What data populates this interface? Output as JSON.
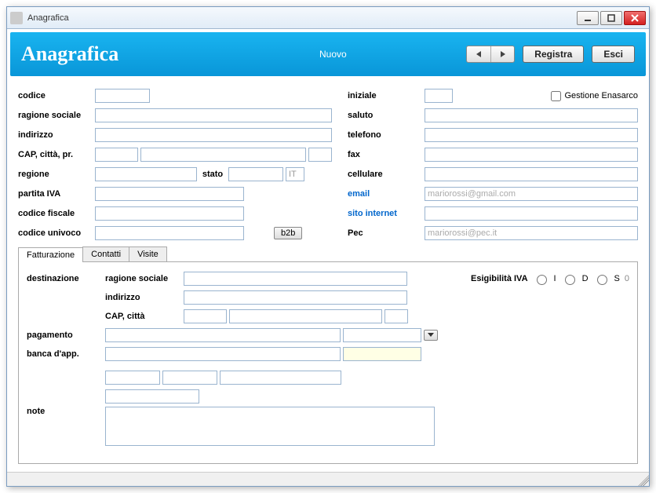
{
  "window": {
    "title": "Anagrafica"
  },
  "header": {
    "title": "Anagrafica",
    "status": "Nuovo",
    "registra": "Registra",
    "esci": "Esci"
  },
  "left": {
    "codice": "codice",
    "ragione_sociale": "ragione sociale",
    "indirizzo": "indirizzo",
    "cap_citta_pr": "CAP, città, pr.",
    "regione": "regione",
    "stato": "stato",
    "stato_val": "IT",
    "partita_iva": "partita IVA",
    "codice_fiscale": "codice fiscale",
    "codice_univoco": "codice univoco",
    "b2b": "b2b"
  },
  "right": {
    "iniziale": "iniziale",
    "gestione_enasarco": "Gestione Enasarco",
    "saluto": "saluto",
    "telefono": "telefono",
    "fax": "fax",
    "cellulare": "cellulare",
    "email": "email",
    "email_ph": "mariorossi@gmail.com",
    "sito": "sito internet",
    "pec": "Pec",
    "pec_ph": "mariorossi@pec.it"
  },
  "tabs": {
    "fatturazione": "Fatturazione",
    "contatti": "Contatti",
    "visite": "Visite"
  },
  "fatt": {
    "destinazione": "destinazione",
    "ragione_sociale": "ragione sociale",
    "indirizzo": "indirizzo",
    "cap_citta": "CAP, città",
    "pagamento": "pagamento",
    "banca": "banca d'app.",
    "note": "note",
    "esigibilita": "Esigibilità IVA",
    "opt_i": "I",
    "opt_d": "D",
    "opt_s": "S",
    "opt_s_suffix": "0"
  }
}
